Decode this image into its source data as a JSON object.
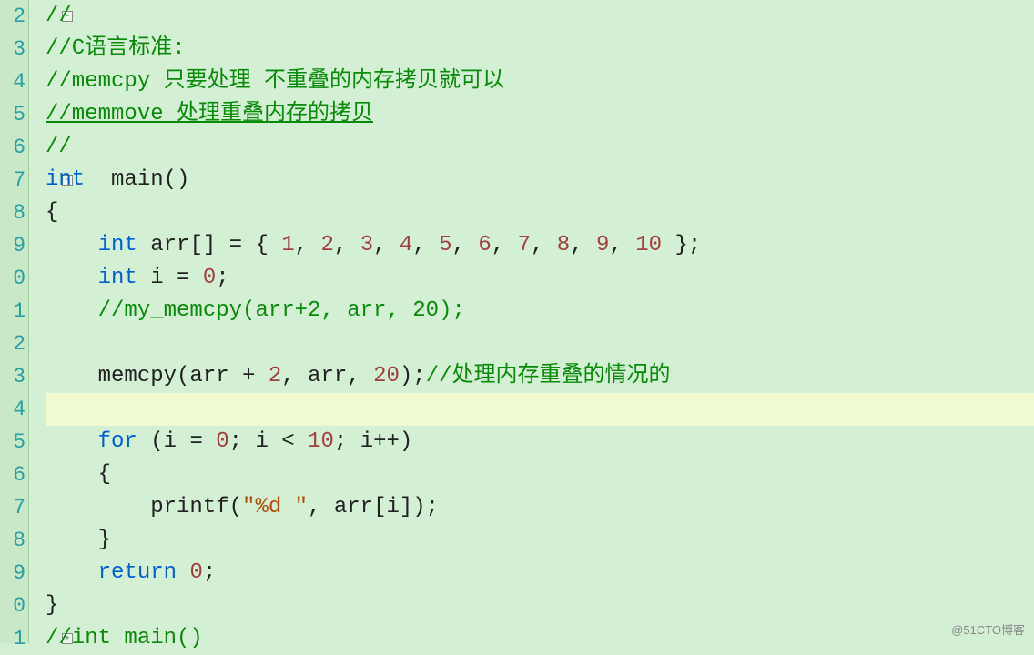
{
  "lines": [
    {
      "num": "2",
      "fold": "-",
      "parts": [
        {
          "cls": "c-comment",
          "text": "//"
        }
      ]
    },
    {
      "num": "3",
      "parts": [
        {
          "cls": "c-comment",
          "text": "//C语言标准:"
        }
      ]
    },
    {
      "num": "4",
      "parts": [
        {
          "cls": "c-comment",
          "text": "//memcpy 只要处理 不重叠的内存拷贝就可以"
        }
      ]
    },
    {
      "num": "5",
      "parts": [
        {
          "cls": "c-comment underline",
          "text": "//memmove 处理重叠内存的拷贝"
        }
      ]
    },
    {
      "num": "6",
      "parts": [
        {
          "cls": "c-comment",
          "text": "//"
        }
      ]
    },
    {
      "num": "7",
      "fold": "-",
      "parts": [
        {
          "cls": "c-keyword",
          "text": "int"
        },
        {
          "cls": "c-text",
          "text": "  main()"
        }
      ]
    },
    {
      "num": "8",
      "parts": [
        {
          "cls": "c-text",
          "text": "{"
        }
      ]
    },
    {
      "num": "9",
      "parts": [
        {
          "cls": "c-text",
          "text": "    "
        },
        {
          "cls": "c-keyword",
          "text": "int"
        },
        {
          "cls": "c-text",
          "text": " arr[] = { "
        },
        {
          "cls": "c-number",
          "text": "1"
        },
        {
          "cls": "c-text",
          "text": ", "
        },
        {
          "cls": "c-number",
          "text": "2"
        },
        {
          "cls": "c-text",
          "text": ", "
        },
        {
          "cls": "c-number",
          "text": "3"
        },
        {
          "cls": "c-text",
          "text": ", "
        },
        {
          "cls": "c-number",
          "text": "4"
        },
        {
          "cls": "c-text",
          "text": ", "
        },
        {
          "cls": "c-number",
          "text": "5"
        },
        {
          "cls": "c-text",
          "text": ", "
        },
        {
          "cls": "c-number",
          "text": "6"
        },
        {
          "cls": "c-text",
          "text": ", "
        },
        {
          "cls": "c-number",
          "text": "7"
        },
        {
          "cls": "c-text",
          "text": ", "
        },
        {
          "cls": "c-number",
          "text": "8"
        },
        {
          "cls": "c-text",
          "text": ", "
        },
        {
          "cls": "c-number",
          "text": "9"
        },
        {
          "cls": "c-text",
          "text": ", "
        },
        {
          "cls": "c-number",
          "text": "10"
        },
        {
          "cls": "c-text",
          "text": " };"
        }
      ]
    },
    {
      "num": "0",
      "parts": [
        {
          "cls": "c-text",
          "text": "    "
        },
        {
          "cls": "c-keyword",
          "text": "int"
        },
        {
          "cls": "c-text",
          "text": " i = "
        },
        {
          "cls": "c-number",
          "text": "0"
        },
        {
          "cls": "c-text",
          "text": ";"
        }
      ]
    },
    {
      "num": "1",
      "parts": [
        {
          "cls": "c-text",
          "text": "    "
        },
        {
          "cls": "c-comment",
          "text": "//my_memcpy(arr+2, arr, 20);"
        }
      ]
    },
    {
      "num": "2",
      "parts": []
    },
    {
      "num": "3",
      "parts": [
        {
          "cls": "c-text",
          "text": "    memcpy(arr + "
        },
        {
          "cls": "c-number",
          "text": "2"
        },
        {
          "cls": "c-text",
          "text": ", arr, "
        },
        {
          "cls": "c-number",
          "text": "20"
        },
        {
          "cls": "c-text",
          "text": ");"
        },
        {
          "cls": "c-comment",
          "text": "//处理内存重叠的情况的"
        }
      ]
    },
    {
      "num": "4",
      "highlight": true,
      "parts": []
    },
    {
      "num": "5",
      "parts": [
        {
          "cls": "c-text",
          "text": "    "
        },
        {
          "cls": "c-keyword",
          "text": "for"
        },
        {
          "cls": "c-text",
          "text": " (i = "
        },
        {
          "cls": "c-number",
          "text": "0"
        },
        {
          "cls": "c-text",
          "text": "; i < "
        },
        {
          "cls": "c-number",
          "text": "10"
        },
        {
          "cls": "c-text",
          "text": "; i++)"
        }
      ]
    },
    {
      "num": "6",
      "parts": [
        {
          "cls": "c-text",
          "text": "    {"
        }
      ]
    },
    {
      "num": "7",
      "parts": [
        {
          "cls": "c-text",
          "text": "        printf("
        },
        {
          "cls": "c-string",
          "text": "\"%d \""
        },
        {
          "cls": "c-text",
          "text": ", arr[i]);"
        }
      ]
    },
    {
      "num": "8",
      "parts": [
        {
          "cls": "c-text",
          "text": "    }"
        }
      ]
    },
    {
      "num": "9",
      "parts": [
        {
          "cls": "c-text",
          "text": "    "
        },
        {
          "cls": "c-keyword",
          "text": "return"
        },
        {
          "cls": "c-text",
          "text": " "
        },
        {
          "cls": "c-number",
          "text": "0"
        },
        {
          "cls": "c-text",
          "text": ";"
        }
      ]
    },
    {
      "num": "0",
      "parts": [
        {
          "cls": "c-text",
          "text": "}"
        }
      ]
    },
    {
      "num": "1",
      "fold": "+",
      "parts": [
        {
          "cls": "c-comment",
          "text": "//int main()"
        }
      ]
    }
  ],
  "watermark": "@51CTO博客"
}
